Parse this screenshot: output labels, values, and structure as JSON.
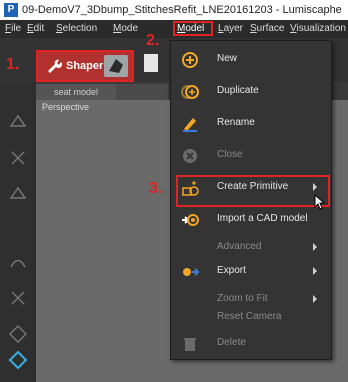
{
  "window": {
    "title": "09-DemoV7_3Dbump_StitchesRefit_LNE20161203 - Lumiscaphe",
    "app_logo_letter": "P"
  },
  "menubar": {
    "items": [
      {
        "label": "File"
      },
      {
        "label": "Edit"
      },
      {
        "label": "Selection"
      },
      {
        "label": "Mode"
      },
      {
        "label": "Model"
      },
      {
        "label": "Layer"
      },
      {
        "label": "Surface"
      },
      {
        "label": "Visualization"
      }
    ]
  },
  "toolbar": {
    "shaper_label": "Shaper"
  },
  "tabs": [
    {
      "label": "seat model"
    }
  ],
  "viewport": {
    "label": "Perspective"
  },
  "menu": {
    "items": [
      {
        "label": "New",
        "icon": "plus-circle-icon",
        "disabled": false,
        "submenu": false
      },
      {
        "label": "Duplicate",
        "icon": "duplicate-icon",
        "disabled": false,
        "submenu": false
      },
      {
        "label": "Rename",
        "icon": "rename-icon",
        "disabled": false,
        "submenu": false
      },
      {
        "label": "Close",
        "icon": "close-circle-icon",
        "disabled": true,
        "submenu": false
      },
      {
        "label": "Create Primitive",
        "icon": "primitive-icon",
        "disabled": false,
        "submenu": true
      },
      {
        "label": "Import a CAD model",
        "icon": "import-icon",
        "disabled": false,
        "submenu": false
      },
      {
        "label": "Advanced",
        "icon": "",
        "disabled": true,
        "submenu": true
      },
      {
        "label": "Export",
        "icon": "export-icon",
        "disabled": false,
        "submenu": true
      },
      {
        "label": "Zoom to Fit",
        "icon": "",
        "disabled": true,
        "submenu": true
      },
      {
        "label": "Reset Camera",
        "icon": "",
        "disabled": true,
        "submenu": false
      },
      {
        "label": "Delete",
        "icon": "trash-icon",
        "disabled": true,
        "submenu": false
      }
    ]
  },
  "annotations": [
    "1.",
    "2.",
    "3."
  ],
  "colors": {
    "accent": "#e02323",
    "orange": "#f5a623",
    "menu_bg": "#343434"
  }
}
